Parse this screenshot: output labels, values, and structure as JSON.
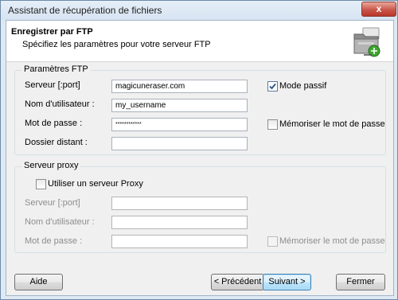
{
  "window": {
    "title": "Assistant de récupération de fichiers",
    "close_symbol": "x"
  },
  "header": {
    "title": "Enregistrer par FTP",
    "subtitle": "Spécifiez les paramètres pour votre serveur FTP",
    "icon": "network-folder-icon"
  },
  "ftp": {
    "group_label": "Paramètres FTP",
    "server_label": "Serveur [:port]",
    "server_value": "magicuneraser.com",
    "username_label": "Nom d'utilisateur :",
    "username_value": "my_username",
    "password_label": "Mot de passe :",
    "password_value": "************",
    "remote_folder_label": "Dossier distant :",
    "remote_folder_value": "",
    "passive_mode_label": "Mode passif",
    "passive_mode_checked": true,
    "remember_password_label": "Mémoriser le mot de passe",
    "remember_password_checked": false
  },
  "proxy": {
    "group_label": "Serveur proxy",
    "use_proxy_label": "Utiliser un serveur Proxy",
    "use_proxy_checked": false,
    "server_label": "Serveur [:port]",
    "username_label": "Nom d'utilisateur :",
    "password_label": "Mot de passe :",
    "remember_password_label": "Mémoriser le mot de passe"
  },
  "buttons": {
    "help": "Aide",
    "previous": "< Précédent",
    "next": "Suivant >",
    "close": "Fermer"
  },
  "colors": {
    "close_button": "#c9574a",
    "default_button_border": "#3c7fb1",
    "checkbox_checked": "#5c7aa8"
  }
}
